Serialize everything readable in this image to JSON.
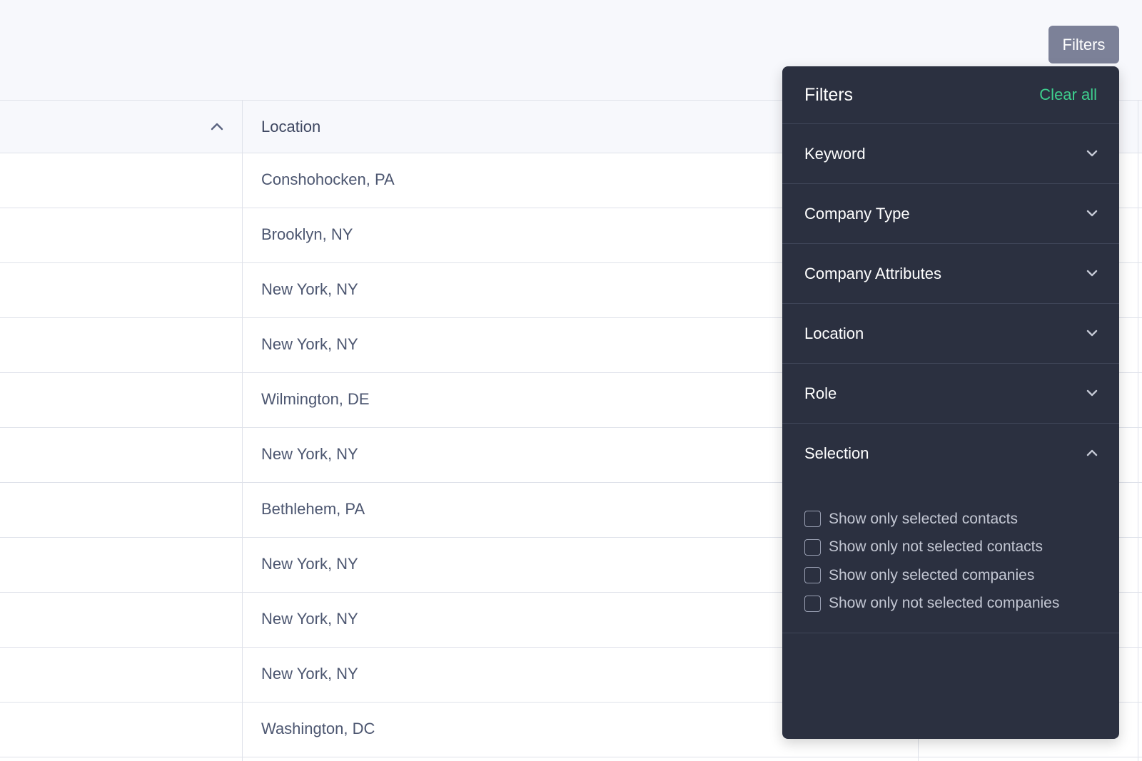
{
  "filters_button": {
    "label": "Filters"
  },
  "table": {
    "header": {
      "location": "Location"
    },
    "rows": [
      {
        "location": "Conshohocken, PA"
      },
      {
        "location": "Brooklyn, NY"
      },
      {
        "location": "New York, NY"
      },
      {
        "location": "New York, NY"
      },
      {
        "location": "Wilmington, DE"
      },
      {
        "location": "New York, NY"
      },
      {
        "location": "Bethlehem, PA"
      },
      {
        "location": "New York, NY"
      },
      {
        "location": "New York, NY"
      },
      {
        "location": "New York, NY"
      },
      {
        "location": "Washington, DC"
      }
    ]
  },
  "panel": {
    "title": "Filters",
    "clear_all": "Clear all",
    "sections": [
      {
        "label": "Keyword",
        "icon": "chevron-down-icon"
      },
      {
        "label": "Company Type",
        "icon": "chevron-down-icon"
      },
      {
        "label": "Company Attributes",
        "icon": "chevron-down-icon"
      },
      {
        "label": "Location",
        "icon": "chevron-down-icon"
      },
      {
        "label": "Role",
        "icon": "chevron-down-icon"
      },
      {
        "label": "Selection",
        "icon": "chevron-up-icon"
      }
    ],
    "selection_options": [
      {
        "label": "Show only selected contacts",
        "checked": false
      },
      {
        "label": "Show only not selected contacts",
        "checked": false
      },
      {
        "label": "Show only selected companies",
        "checked": false
      },
      {
        "label": "Show only not selected companies",
        "checked": false
      }
    ]
  },
  "colors": {
    "panel_bg": "#2b3040",
    "accent_green": "#3ecf8e",
    "button_bg": "#7c8198"
  }
}
